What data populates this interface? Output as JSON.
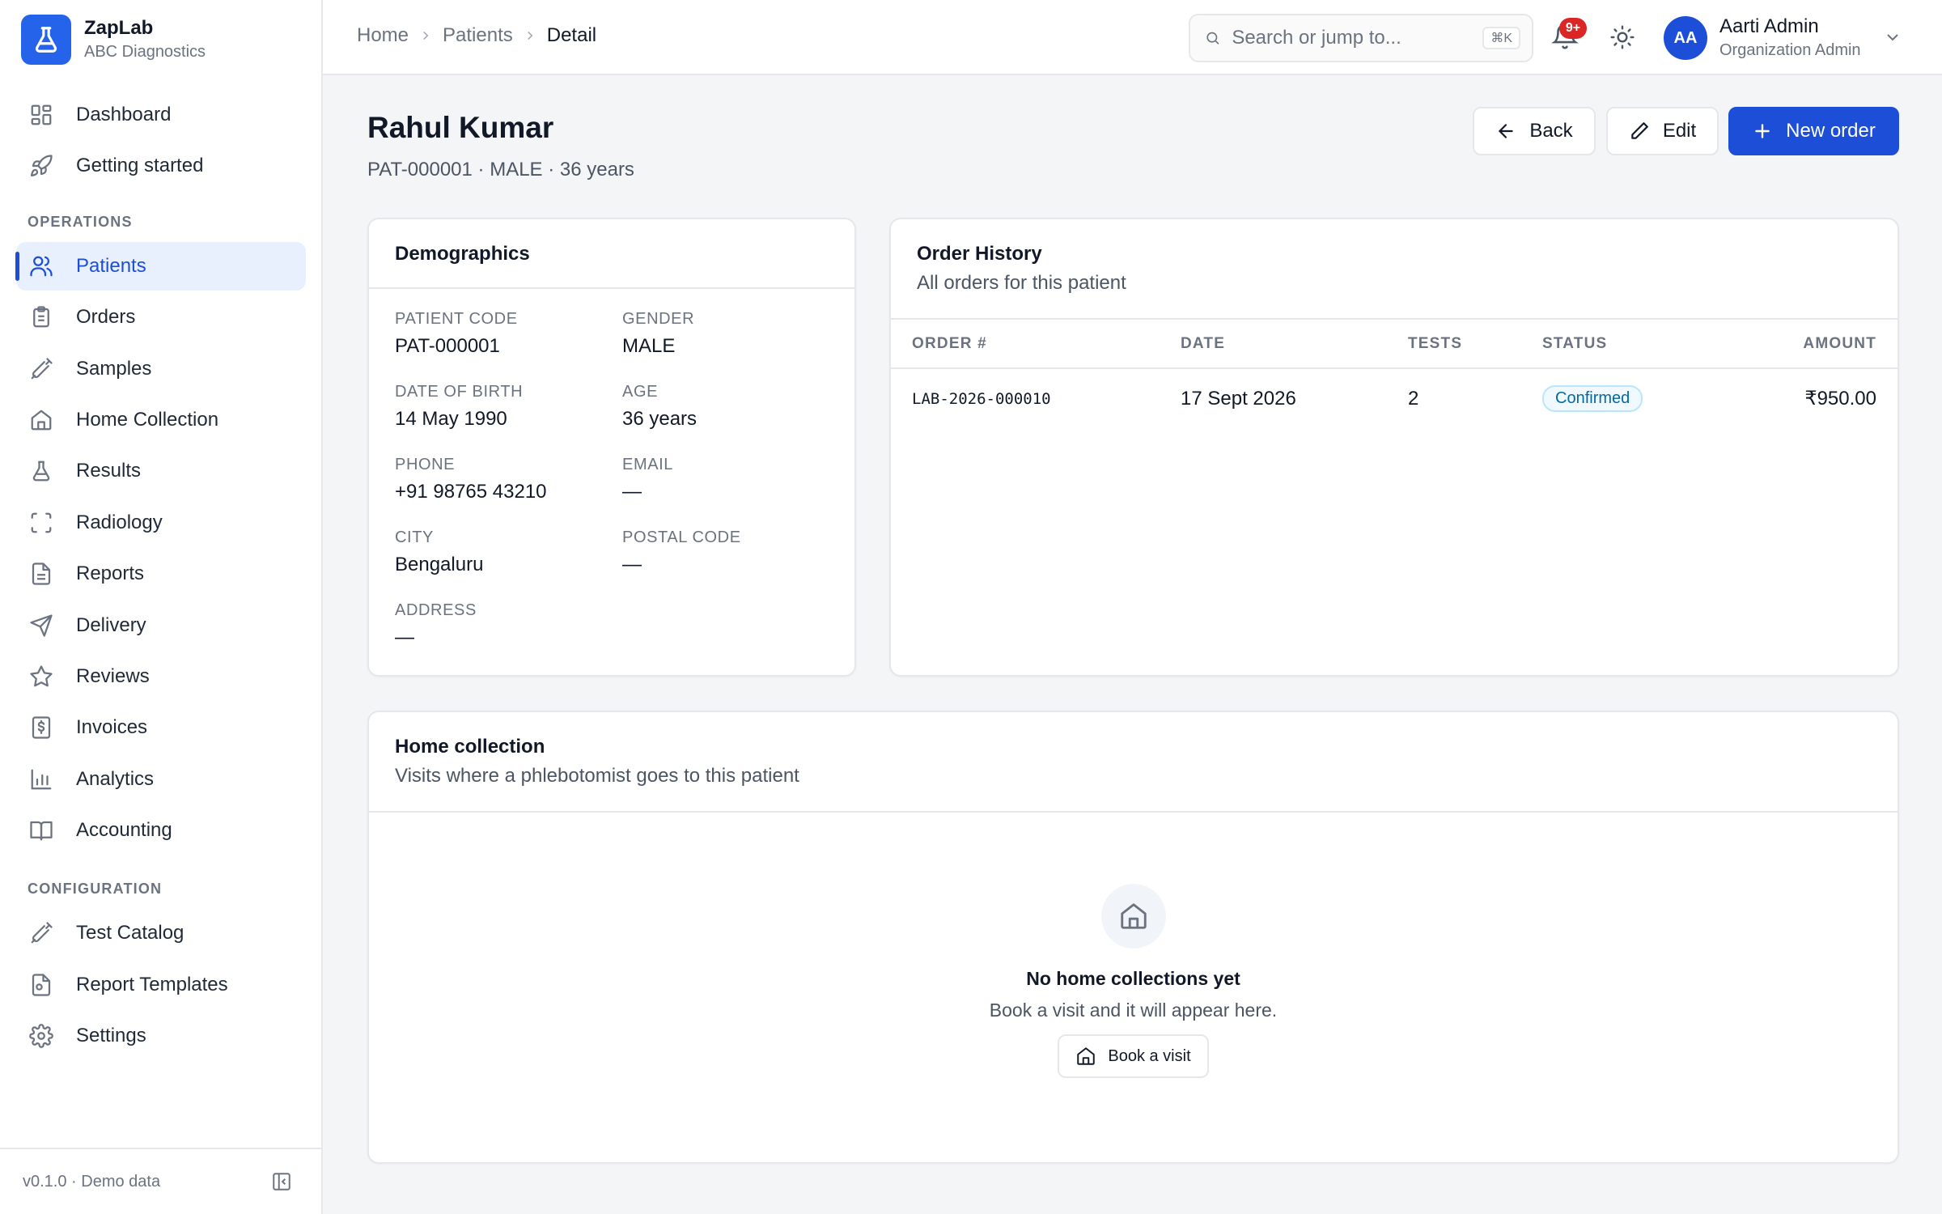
{
  "brand": {
    "name": "ZapLab",
    "org": "ABC Diagnostics",
    "accent": "#2563eb"
  },
  "nav": {
    "top": [
      {
        "label": "Dashboard",
        "icon": "dashboard-icon"
      },
      {
        "label": "Getting started",
        "icon": "rocket-icon"
      }
    ],
    "operations_heading": "OPERATIONS",
    "operations": [
      {
        "label": "Patients",
        "icon": "users-icon",
        "active": true
      },
      {
        "label": "Orders",
        "icon": "clipboard-icon"
      },
      {
        "label": "Samples",
        "icon": "syringe-icon"
      },
      {
        "label": "Home Collection",
        "icon": "home-icon"
      },
      {
        "label": "Results",
        "icon": "flask-icon"
      },
      {
        "label": "Radiology",
        "icon": "scan-icon"
      },
      {
        "label": "Reports",
        "icon": "file-text-icon"
      },
      {
        "label": "Delivery",
        "icon": "send-icon"
      },
      {
        "label": "Reviews",
        "icon": "star-icon"
      },
      {
        "label": "Invoices",
        "icon": "receipt-icon"
      },
      {
        "label": "Analytics",
        "icon": "bar-chart-icon"
      },
      {
        "label": "Accounting",
        "icon": "book-icon"
      }
    ],
    "configuration_heading": "CONFIGURATION",
    "configuration": [
      {
        "label": "Test Catalog",
        "icon": "syringe-icon"
      },
      {
        "label": "Report Templates",
        "icon": "file-settings-icon"
      },
      {
        "label": "Settings",
        "icon": "gear-icon"
      }
    ],
    "footer": "v0.1.0 · Demo data"
  },
  "topbar": {
    "breadcrumb": [
      "Home",
      "Patients",
      "Detail"
    ],
    "search_placeholder": "Search or jump to...",
    "search_shortcut": "⌘K",
    "notifications_badge": "9+",
    "user": {
      "initials": "AA",
      "name": "Aarti Admin",
      "role": "Organization Admin"
    }
  },
  "page": {
    "title": "Rahul Kumar",
    "subtitle": "PAT-000001 · MALE · 36 years",
    "back_label": "Back",
    "edit_label": "Edit",
    "new_order_label": "New order"
  },
  "demographics": {
    "title": "Demographics",
    "fields": {
      "patient_code": {
        "label": "PATIENT CODE",
        "value": "PAT-000001"
      },
      "gender": {
        "label": "GENDER",
        "value": "MALE"
      },
      "dob": {
        "label": "DATE OF BIRTH",
        "value": "14 May 1990"
      },
      "age": {
        "label": "AGE",
        "value": "36 years"
      },
      "phone": {
        "label": "PHONE",
        "value": "+91 98765 43210"
      },
      "email": {
        "label": "EMAIL",
        "value": "—"
      },
      "city": {
        "label": "CITY",
        "value": "Bengaluru"
      },
      "postal": {
        "label": "POSTAL CODE",
        "value": "—"
      },
      "address": {
        "label": "ADDRESS",
        "value": "—"
      }
    }
  },
  "order_history": {
    "title": "Order History",
    "description": "All orders for this patient",
    "columns": {
      "order": "ORDER #",
      "date": "DATE",
      "tests": "TESTS",
      "status": "STATUS",
      "amount": "AMOUNT"
    },
    "rows": [
      {
        "order": "LAB-2026-000010",
        "date": "17 Sept 2026",
        "tests": "2",
        "status": "Confirmed",
        "amount": "₹950.00"
      }
    ]
  },
  "home_collection": {
    "title": "Home collection",
    "description": "Visits where a phlebotomist goes to this patient",
    "empty_title": "No home collections yet",
    "empty_desc": "Book a visit and it will appear here.",
    "book_label": "Book a visit"
  }
}
